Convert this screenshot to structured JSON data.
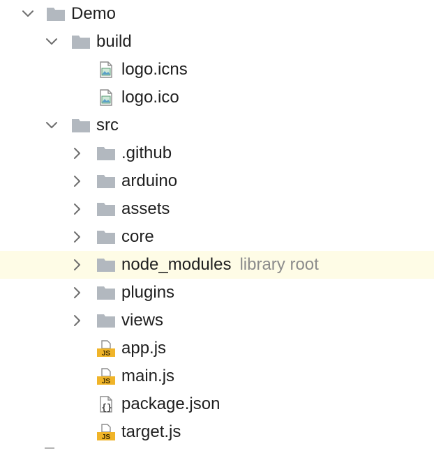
{
  "tree": [
    {
      "label": "Demo",
      "kind": "folder",
      "expander": "expanded",
      "depth": 0,
      "icon": "folder-icon"
    },
    {
      "label": "build",
      "kind": "folder",
      "expander": "expanded",
      "depth": 1,
      "icon": "folder-icon"
    },
    {
      "label": "logo.icns",
      "kind": "file",
      "expander": "none",
      "depth": 2,
      "icon": "image-file-icon"
    },
    {
      "label": "logo.ico",
      "kind": "file",
      "expander": "none",
      "depth": 2,
      "icon": "image-file-icon"
    },
    {
      "label": "src",
      "kind": "folder",
      "expander": "expanded",
      "depth": 1,
      "icon": "folder-icon"
    },
    {
      "label": ".github",
      "kind": "folder",
      "expander": "collapsed",
      "depth": 2,
      "icon": "folder-icon"
    },
    {
      "label": "arduino",
      "kind": "folder",
      "expander": "collapsed",
      "depth": 2,
      "icon": "folder-icon"
    },
    {
      "label": "assets",
      "kind": "folder",
      "expander": "collapsed",
      "depth": 2,
      "icon": "folder-icon"
    },
    {
      "label": "core",
      "kind": "folder",
      "expander": "collapsed",
      "depth": 2,
      "icon": "folder-icon"
    },
    {
      "label": "node_modules",
      "hint": "library root",
      "kind": "folder",
      "expander": "collapsed",
      "depth": 2,
      "icon": "folder-icon",
      "highlighted": true
    },
    {
      "label": "plugins",
      "kind": "folder",
      "expander": "collapsed",
      "depth": 2,
      "icon": "folder-icon"
    },
    {
      "label": "views",
      "kind": "folder",
      "expander": "collapsed",
      "depth": 2,
      "icon": "folder-icon"
    },
    {
      "label": "app.js",
      "kind": "file",
      "expander": "none",
      "depth": 2,
      "icon": "js-file-icon"
    },
    {
      "label": "main.js",
      "kind": "file",
      "expander": "none",
      "depth": 2,
      "icon": "js-file-icon"
    },
    {
      "label": "package.json",
      "kind": "file",
      "expander": "none",
      "depth": 2,
      "icon": "json-file-icon"
    },
    {
      "label": "target.js",
      "kind": "file",
      "expander": "none",
      "depth": 2,
      "icon": "js-file-icon"
    }
  ],
  "icons": {
    "js_badge": "JS"
  },
  "colors": {
    "folder": "#b2b8bf",
    "chevron": "#6e6e6e",
    "js_badge": "#f0b429",
    "highlight_row": "#fefce6",
    "hint_text": "#8c8c8c"
  }
}
